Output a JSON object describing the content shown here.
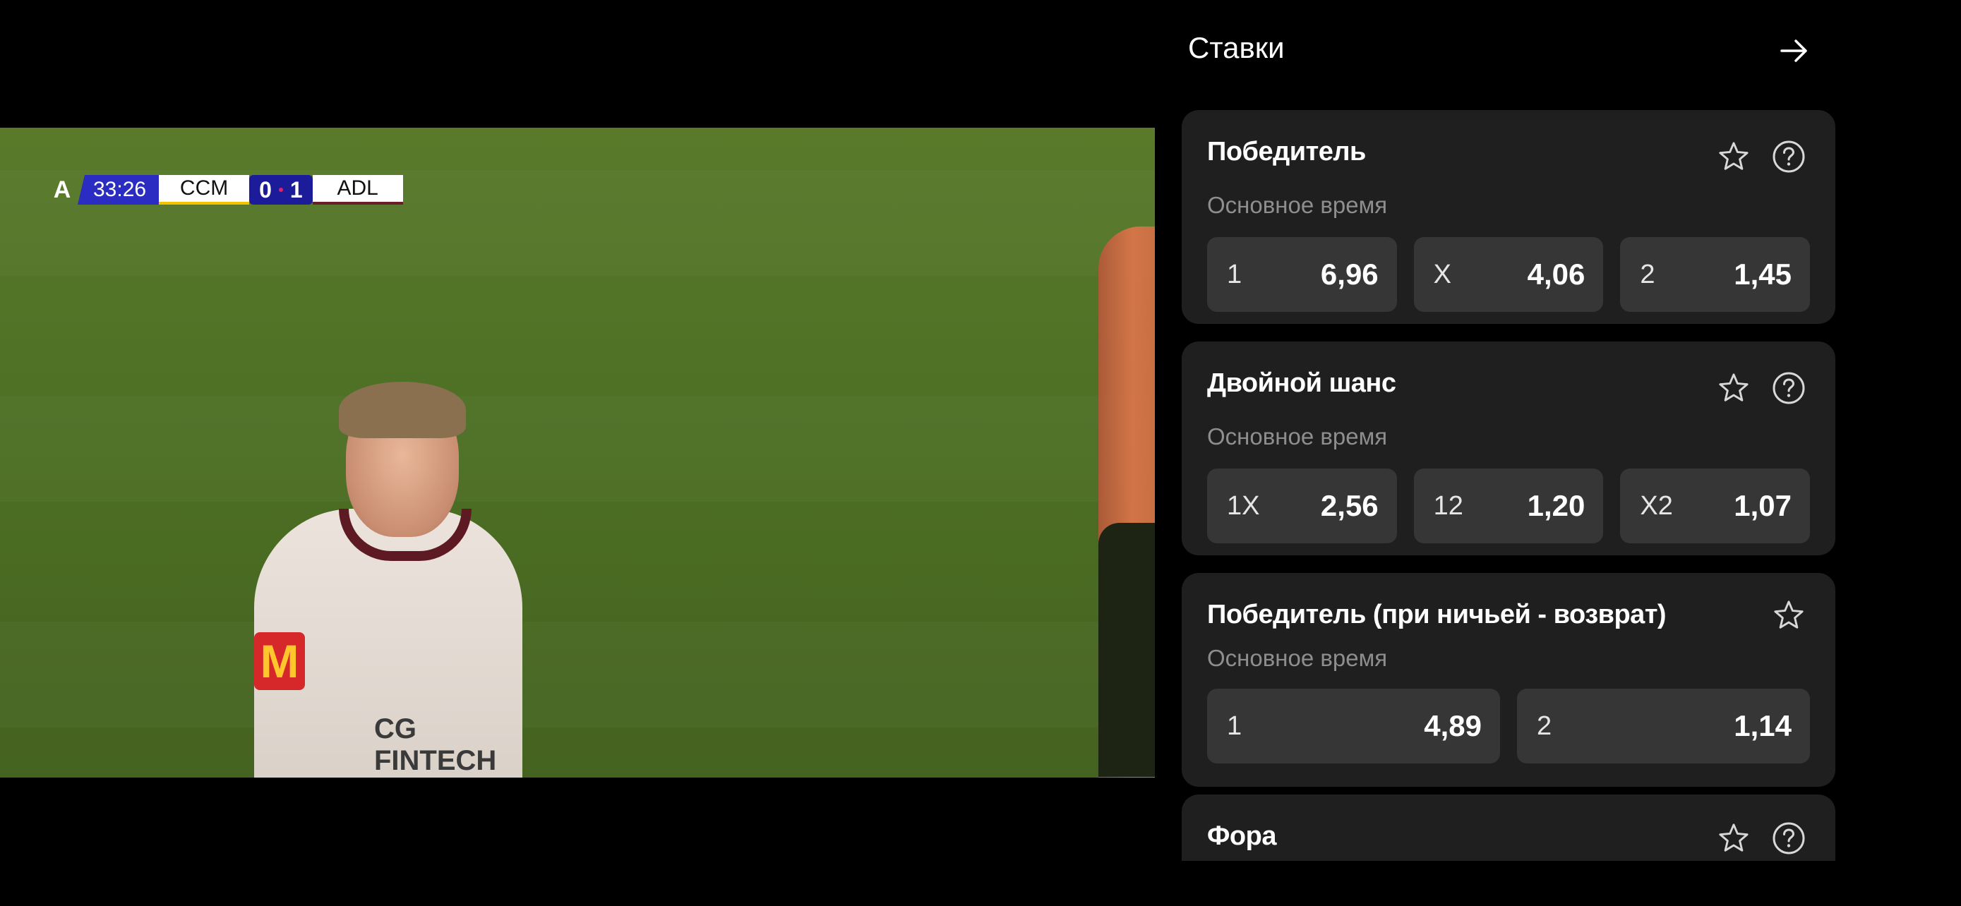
{
  "scorebug": {
    "clock": "33:26",
    "home_team": "CCM",
    "home_score": "0",
    "away_score": "1",
    "away_team": "ADL",
    "logo": "A"
  },
  "video_text": {
    "jersey_badge": "M",
    "jersey_sponsor": "CG FINTECH"
  },
  "panel": {
    "title": "Ставки",
    "close_icon": "arrow-right-icon"
  },
  "markets": [
    {
      "title": "Победитель",
      "subtitle": "Основное время",
      "has_help": true,
      "odds": [
        {
          "label": "1",
          "value": "6,96"
        },
        {
          "label": "X",
          "value": "4,06"
        },
        {
          "label": "2",
          "value": "1,45"
        }
      ]
    },
    {
      "title": "Двойной шанс",
      "subtitle": "Основное время",
      "has_help": true,
      "odds": [
        {
          "label": "1X",
          "value": "2,56"
        },
        {
          "label": "12",
          "value": "1,20"
        },
        {
          "label": "X2",
          "value": "1,07"
        }
      ]
    },
    {
      "title": "Победитель (при ничьей - возврат)",
      "subtitle": "Основное время",
      "has_help": false,
      "odds": [
        {
          "label": "1",
          "value": "4,89"
        },
        {
          "label": "2",
          "value": "1,14"
        }
      ]
    },
    {
      "title": "Фора",
      "has_help": true
    }
  ],
  "colors": {
    "background": "#000000",
    "card": "#1f1f1f",
    "odd_button": "#363636",
    "subtitle": "#8e8e8e",
    "clock_bg": "#2a2cc2"
  }
}
